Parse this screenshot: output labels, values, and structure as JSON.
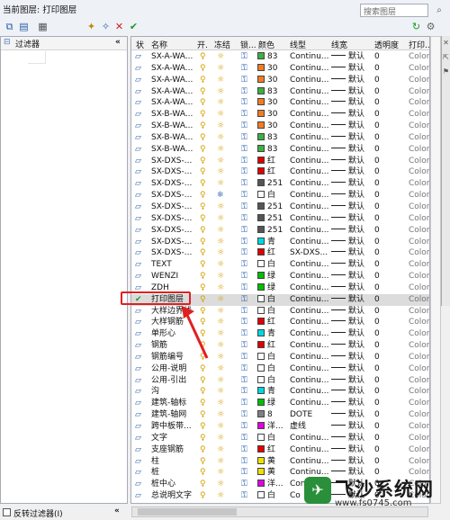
{
  "header": {
    "current_layer": "当前图层: 打印图层",
    "search_placeholder": "搜索图层"
  },
  "left_panel": {
    "title": "过滤器",
    "invert_label": "反转过滤器(I)"
  },
  "columns": [
    "状",
    "名称",
    "开.",
    "冻结",
    "锁...",
    "颜色",
    "线型",
    "线宽",
    "透明度",
    "打印..."
  ],
  "layers": [
    {
      "name": "SX-A-WA...",
      "color": "83",
      "hex": "#3cb043",
      "linetype": "Continu...",
      "lw": "默认",
      "tr": "0",
      "plot": "Color...",
      "st": "l",
      "frz": "s",
      "lock": "u"
    },
    {
      "name": "SX-A-WA...",
      "color": "30",
      "hex": "#f47c20",
      "linetype": "Continu...",
      "lw": "默认",
      "tr": "0",
      "plot": "Color...",
      "st": "l",
      "frz": "s",
      "lock": "u"
    },
    {
      "name": "SX-A-WA...",
      "color": "30",
      "hex": "#f47c20",
      "linetype": "Continu...",
      "lw": "默认",
      "tr": "0",
      "plot": "Color...",
      "st": "l",
      "frz": "s",
      "lock": "u"
    },
    {
      "name": "SX-A-WA...",
      "color": "83",
      "hex": "#3cb043",
      "linetype": "Continu...",
      "lw": "默认",
      "tr": "0",
      "plot": "Color...",
      "st": "l",
      "frz": "s",
      "lock": "u"
    },
    {
      "name": "SX-A-WA...",
      "color": "30",
      "hex": "#f47c20",
      "linetype": "Continu...",
      "lw": "默认",
      "tr": "0",
      "plot": "Color...",
      "st": "l",
      "frz": "s",
      "lock": "u"
    },
    {
      "name": "SX-B-WA...",
      "color": "30",
      "hex": "#f47c20",
      "linetype": "Continu...",
      "lw": "默认",
      "tr": "0",
      "plot": "Color...",
      "st": "l",
      "frz": "s",
      "lock": "u"
    },
    {
      "name": "SX-B-WA...",
      "color": "30",
      "hex": "#f47c20",
      "linetype": "Continu...",
      "lw": "默认",
      "tr": "0",
      "plot": "Color...",
      "st": "l",
      "frz": "s",
      "lock": "u"
    },
    {
      "name": "SX-B-WA...",
      "color": "83",
      "hex": "#3cb043",
      "linetype": "Continu...",
      "lw": "默认",
      "tr": "0",
      "plot": "Color...",
      "st": "l",
      "frz": "s",
      "lock": "u"
    },
    {
      "name": "SX-B-WA...",
      "color": "83",
      "hex": "#3cb043",
      "linetype": "Continu...",
      "lw": "默认",
      "tr": "0",
      "plot": "Color...",
      "st": "l",
      "frz": "s",
      "lock": "u"
    },
    {
      "name": "SX-DXS-...",
      "color": "红",
      "hex": "#e00000",
      "linetype": "Continu...",
      "lw": "默认",
      "tr": "0",
      "plot": "Color...",
      "st": "l",
      "frz": "s",
      "lock": "u"
    },
    {
      "name": "SX-DXS-...",
      "color": "红",
      "hex": "#e00000",
      "linetype": "Continu...",
      "lw": "默认",
      "tr": "0",
      "plot": "Color...",
      "st": "l",
      "frz": "s",
      "lock": "u"
    },
    {
      "name": "SX-DXS-...",
      "color": "251",
      "hex": "#555555",
      "linetype": "Continu...",
      "lw": "默认",
      "tr": "0",
      "plot": "Color...",
      "st": "l",
      "frz": "s",
      "lock": "u"
    },
    {
      "name": "SX-DXS-...",
      "color": "白",
      "hex": "#ffffff",
      "linetype": "Continu...",
      "lw": "默认",
      "tr": "0",
      "plot": "Color...",
      "st": "l",
      "frz": "f",
      "lock": "u"
    },
    {
      "name": "SX-DXS-...",
      "color": "251",
      "hex": "#555555",
      "linetype": "Continu...",
      "lw": "默认",
      "tr": "0",
      "plot": "Color...",
      "st": "l",
      "frz": "s",
      "lock": "u"
    },
    {
      "name": "SX-DXS-...",
      "color": "251",
      "hex": "#555555",
      "linetype": "Continu...",
      "lw": "默认",
      "tr": "0",
      "plot": "Color...",
      "st": "l",
      "frz": "s",
      "lock": "u"
    },
    {
      "name": "SX-DXS-...",
      "color": "251",
      "hex": "#555555",
      "linetype": "Continu...",
      "lw": "默认",
      "tr": "0",
      "plot": "Color...",
      "st": "l",
      "frz": "s",
      "lock": "u"
    },
    {
      "name": "SX-DXS-...",
      "color": "青",
      "hex": "#00d8e0",
      "linetype": "Continu...",
      "lw": "默认",
      "tr": "0",
      "plot": "Color...",
      "st": "l",
      "frz": "s",
      "lock": "u"
    },
    {
      "name": "SX-DXS-...",
      "color": "红",
      "hex": "#e00000",
      "linetype": "SX-DXS...",
      "lw": "默认",
      "tr": "0",
      "plot": "Color...",
      "st": "l",
      "frz": "s",
      "lock": "u"
    },
    {
      "name": "TEXT",
      "color": "白",
      "hex": "#ffffff",
      "linetype": "Continu...",
      "lw": "默认",
      "tr": "0",
      "plot": "Color...",
      "st": "l",
      "frz": "s",
      "lock": "u"
    },
    {
      "name": "WENZI",
      "color": "绿",
      "hex": "#00c000",
      "linetype": "Continu...",
      "lw": "默认",
      "tr": "0",
      "plot": "Color...",
      "st": "l",
      "frz": "s",
      "lock": "u"
    },
    {
      "name": "ZDH",
      "color": "绿",
      "hex": "#00c000",
      "linetype": "Continu...",
      "lw": "默认",
      "tr": "0",
      "plot": "Color...",
      "st": "l",
      "frz": "s",
      "lock": "u"
    },
    {
      "name": "打印图层",
      "color": "白",
      "hex": "#ffffff",
      "linetype": "Continu...",
      "lw": "默认",
      "tr": "0",
      "plot": "Color...",
      "st": "c",
      "frz": "s",
      "lock": "u",
      "sel": true
    },
    {
      "name": "大样边界线",
      "color": "白",
      "hex": "#ffffff",
      "linetype": "Continu...",
      "lw": "默认",
      "tr": "0",
      "plot": "Color...",
      "st": "l",
      "frz": "s",
      "lock": "u"
    },
    {
      "name": "大样钢筋",
      "color": "红",
      "hex": "#e00000",
      "linetype": "Continu...",
      "lw": "默认",
      "tr": "0",
      "plot": "Color...",
      "st": "l",
      "frz": "s",
      "lock": "u"
    },
    {
      "name": "单形心",
      "color": "青",
      "hex": "#00d8e0",
      "linetype": "Continu...",
      "lw": "默认",
      "tr": "0",
      "plot": "Color...",
      "st": "l",
      "frz": "s",
      "lock": "u"
    },
    {
      "name": "钢筋",
      "color": "红",
      "hex": "#e00000",
      "linetype": "Continu...",
      "lw": "默认",
      "tr": "0",
      "plot": "Color...",
      "st": "l",
      "frz": "s",
      "lock": "u"
    },
    {
      "name": "钢筋编号",
      "color": "白",
      "hex": "#ffffff",
      "linetype": "Continu...",
      "lw": "默认",
      "tr": "0",
      "plot": "Color...",
      "st": "l",
      "frz": "s",
      "lock": "u"
    },
    {
      "name": "公用-说明",
      "color": "白",
      "hex": "#ffffff",
      "linetype": "Continu...",
      "lw": "默认",
      "tr": "0",
      "plot": "Color...",
      "st": "l",
      "frz": "s",
      "lock": "u"
    },
    {
      "name": "公用-引出",
      "color": "白",
      "hex": "#ffffff",
      "linetype": "Continu...",
      "lw": "默认",
      "tr": "0",
      "plot": "Color...",
      "st": "l",
      "frz": "s",
      "lock": "u"
    },
    {
      "name": "沟",
      "color": "青",
      "hex": "#00d8e0",
      "linetype": "Continu...",
      "lw": "默认",
      "tr": "0",
      "plot": "Color...",
      "st": "l",
      "frz": "s",
      "lock": "u"
    },
    {
      "name": "建筑-轴标",
      "color": "绿",
      "hex": "#00c000",
      "linetype": "Continu...",
      "lw": "默认",
      "tr": "0",
      "plot": "Color...",
      "st": "l",
      "frz": "s",
      "lock": "u"
    },
    {
      "name": "建筑-轴网",
      "color": "8",
      "hex": "#808080",
      "linetype": "DOTE",
      "lw": "默认",
      "tr": "0",
      "plot": "Color...",
      "st": "l",
      "frz": "s",
      "lock": "u"
    },
    {
      "name": "跨中板带...",
      "color": "洋...",
      "hex": "#e000e0",
      "linetype": "虚线",
      "lw": "默认",
      "tr": "0",
      "plot": "Color...",
      "st": "l",
      "frz": "s",
      "lock": "u"
    },
    {
      "name": "文字",
      "color": "白",
      "hex": "#ffffff",
      "linetype": "Continu...",
      "lw": "默认",
      "tr": "0",
      "plot": "Color...",
      "st": "l",
      "frz": "s",
      "lock": "u"
    },
    {
      "name": "支座钢筋",
      "color": "红",
      "hex": "#e00000",
      "linetype": "Continu...",
      "lw": "默认",
      "tr": "0",
      "plot": "Color...",
      "st": "l",
      "frz": "s",
      "lock": "u"
    },
    {
      "name": "柱",
      "color": "黄",
      "hex": "#f0e000",
      "linetype": "Continu...",
      "lw": "默认",
      "tr": "0",
      "plot": "Color...",
      "st": "l",
      "frz": "s",
      "lock": "u"
    },
    {
      "name": "桩",
      "color": "黄",
      "hex": "#f0e000",
      "linetype": "Continu...",
      "lw": "默认",
      "tr": "0",
      "plot": "Color...",
      "st": "l",
      "frz": "s",
      "lock": "u"
    },
    {
      "name": "桩中心",
      "color": "洋...",
      "hex": "#e000e0",
      "linetype": "Conti",
      "lw": "默认",
      "tr": "0",
      "plot": "Color...",
      "st": "l",
      "frz": "s",
      "lock": "u"
    },
    {
      "name": "总说明文字",
      "color": "白",
      "hex": "#ffffff",
      "linetype": "Co",
      "lw": "默认",
      "tr": "0",
      "plot": "Color...",
      "st": "l",
      "frz": "s",
      "lock": "u"
    }
  ],
  "watermark": {
    "title": "飞沙系统网",
    "url": "www.fs0745.com"
  }
}
